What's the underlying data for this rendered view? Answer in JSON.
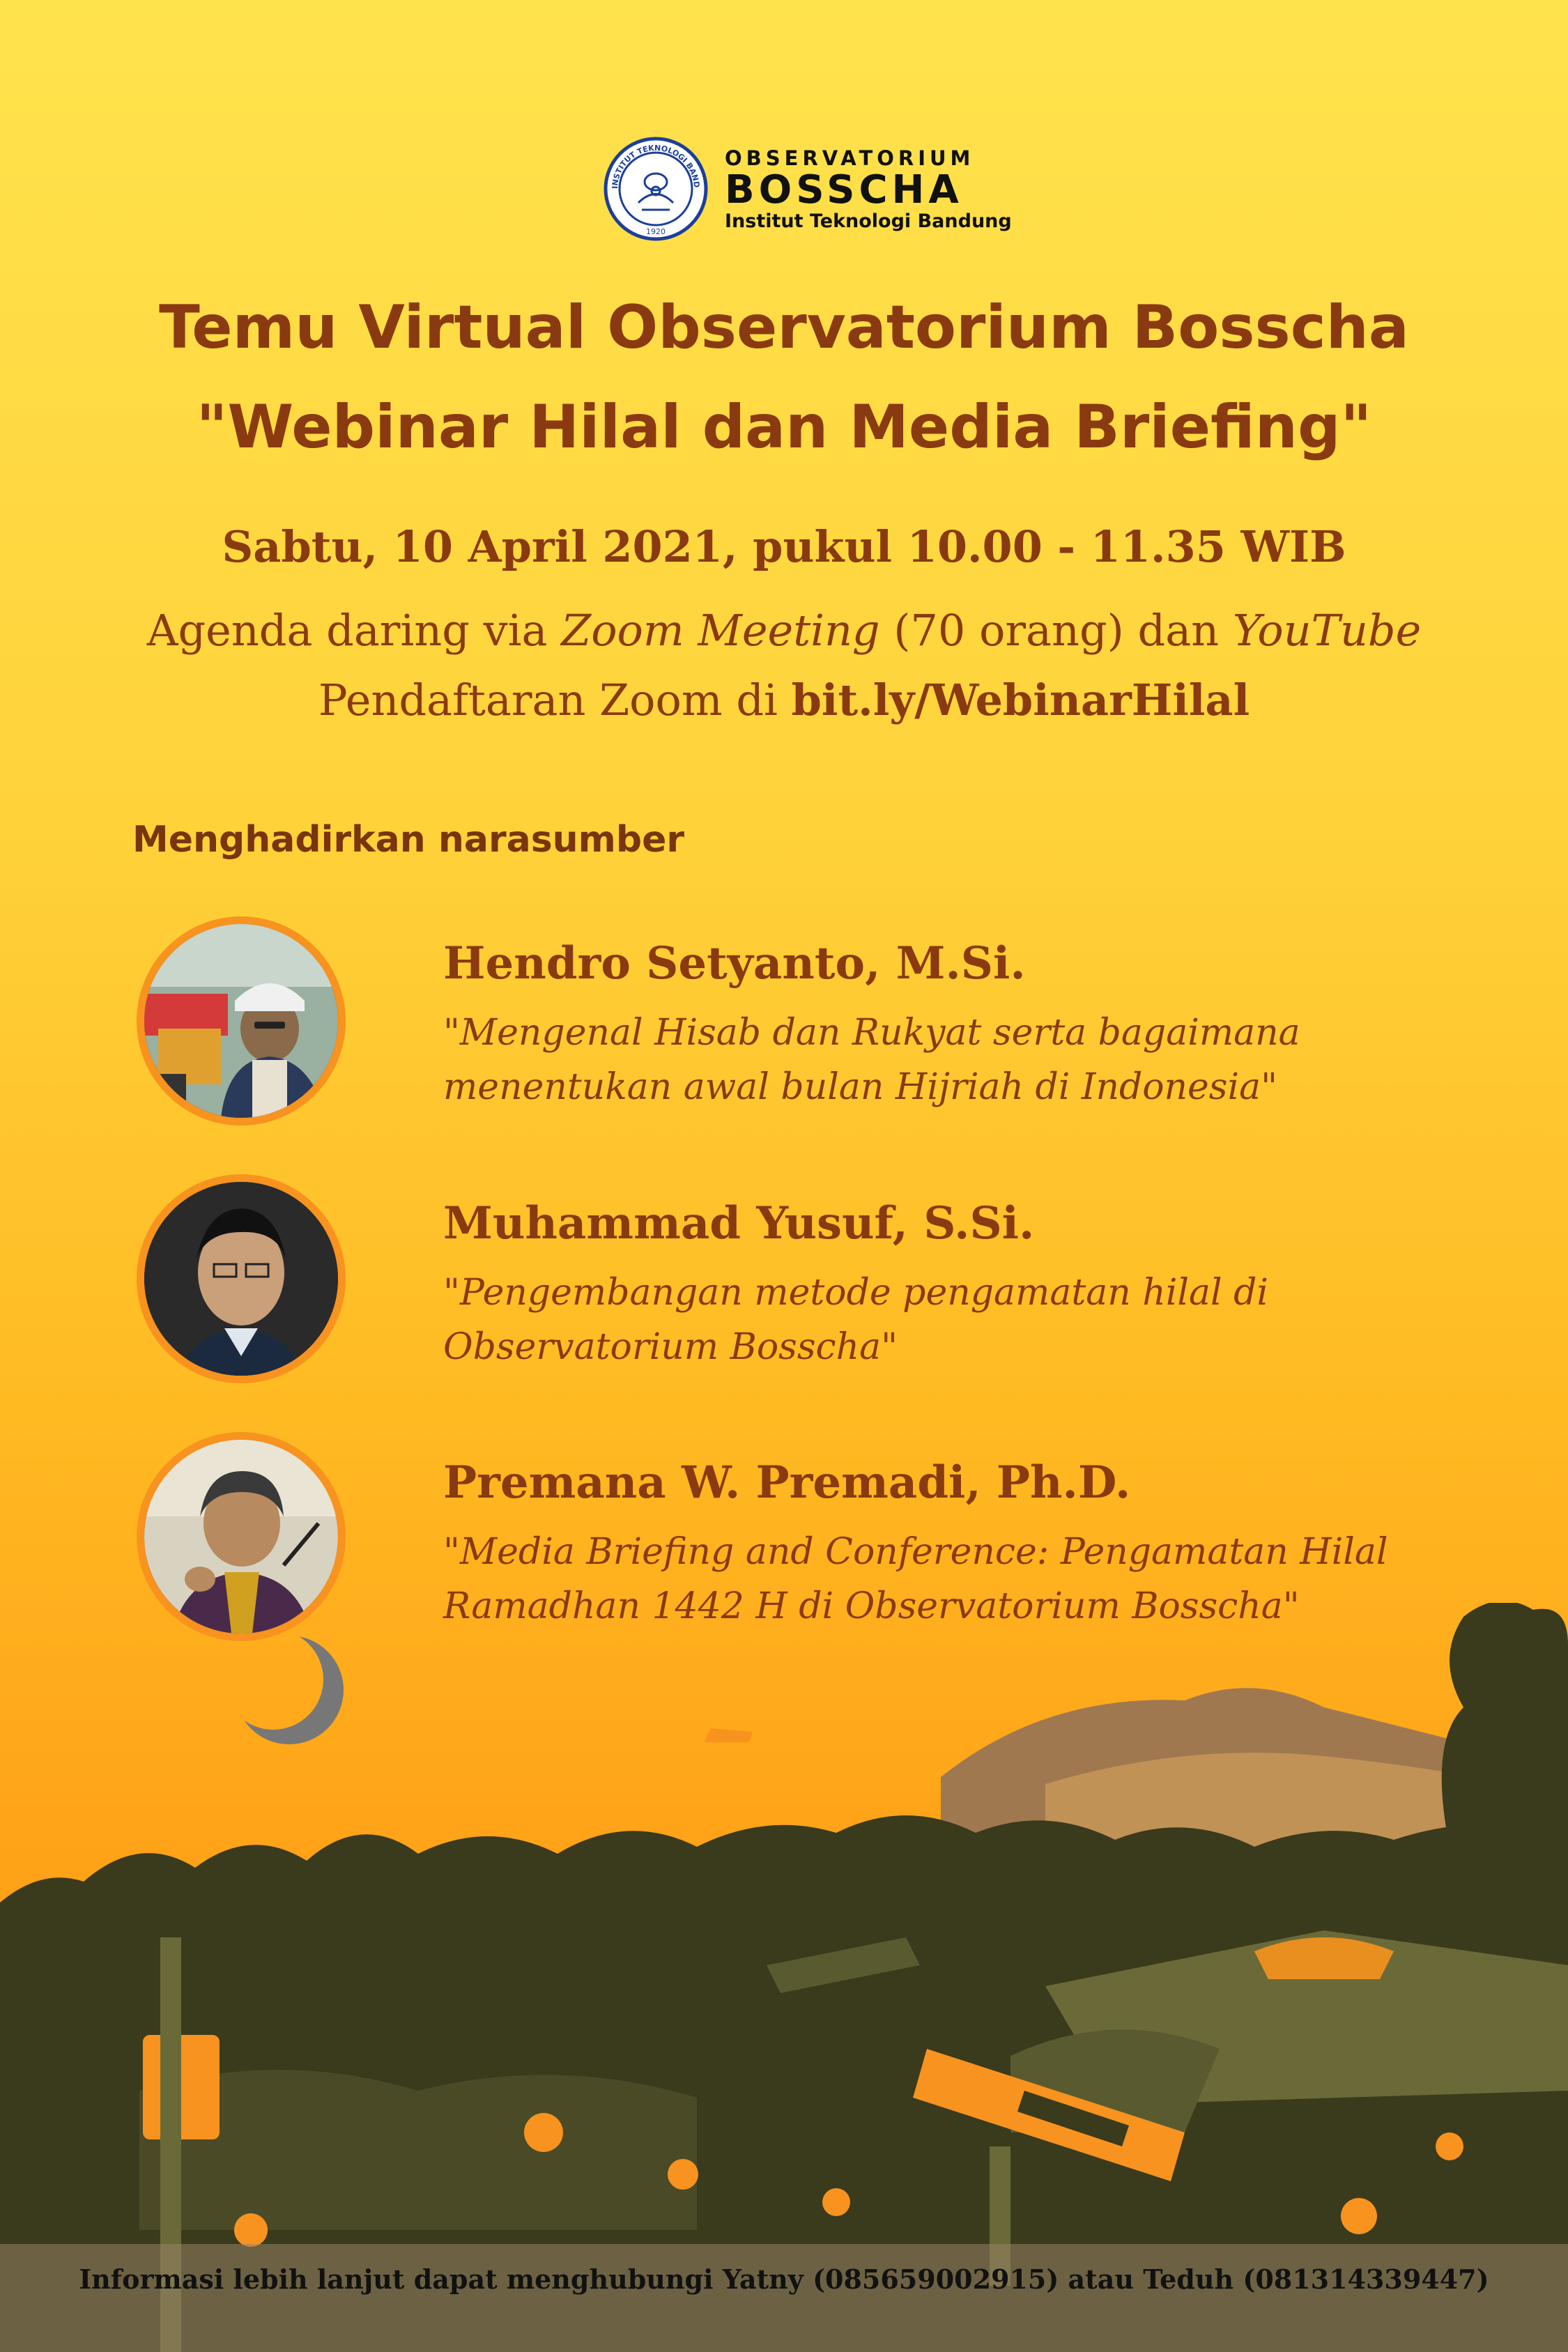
{
  "logo": {
    "line1": "OBSERVATORIUM",
    "line2": "BOSSCHA",
    "line3": "Institut Teknologi Bandung",
    "seal_text": "INSTITUT TEKNOLOGI BANDUNG",
    "seal_year": "1920",
    "seal_color": "#1d3f9a"
  },
  "title": {
    "line1": "Temu Virtual Observatorium Bosscha",
    "line2": "\"Webinar Hilal dan Media Briefing\""
  },
  "event": {
    "date": "Sabtu, 10 April 2021, pukul 10.00 - 11.35 WIB",
    "agenda_prefix": "Agenda daring via ",
    "agenda_zoom": "Zoom Meeting",
    "agenda_mid": " (70 orang) dan ",
    "agenda_youtube": "YouTube",
    "register_prefix": "Pendaftaran Zoom di ",
    "register_link": "bit.ly/WebinarHilal"
  },
  "section_heading": "Menghadirkan narasumber",
  "speakers": [
    {
      "name": "Hendro Setyanto, M.Si.",
      "topic_line1": "\"Mengenal Hisab dan Rukyat serta bagaimana",
      "topic_line2": "menentukan awal bulan Hijriah di Indonesia\""
    },
    {
      "name": "Muhammad  Yusuf, S.Si.",
      "topic_line1": "\"Pengembangan metode pengamatan hilal di",
      "topic_line2": "Observatorium Bosscha\""
    },
    {
      "name": "Premana W. Premadi, Ph.D.",
      "topic_line1": "\"Media Briefing and Conference: Pengamatan Hilal",
      "topic_line2": "Ramadhan 1442 H di Observatorium Bosscha\""
    }
  ],
  "footer": "Informasi lebih lanjut dapat menghubungi Yatny (085659002915) atau Teduh (081314339447)",
  "colors": {
    "text_brown": "#8a3a10",
    "accent_orange": "#f7931e",
    "foliage_dark": "#3a3a1c",
    "mountain": "#a07850"
  }
}
